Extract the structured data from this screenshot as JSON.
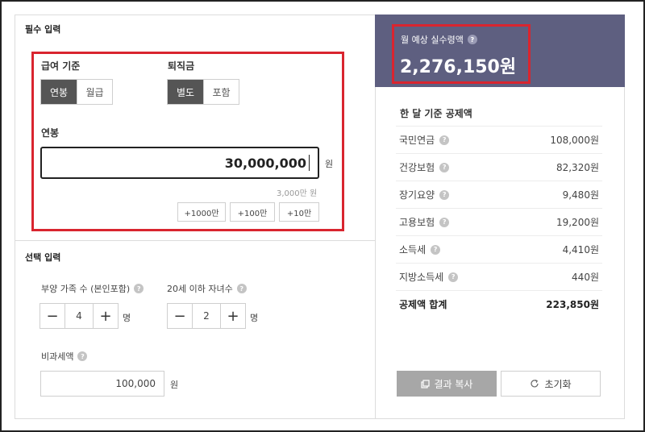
{
  "required": {
    "title": "필수 입력",
    "pay_basis": {
      "label": "급여 기준",
      "options": [
        "연봉",
        "월급"
      ],
      "selected": "연봉"
    },
    "severance": {
      "label": "퇴직금",
      "options": [
        "별도",
        "포함"
      ],
      "selected": "별도"
    },
    "salary": {
      "label": "연봉",
      "value": "30,000,000",
      "unit": "원",
      "hint": "3,000만 원",
      "add_buttons": [
        "+1000만",
        "+100만",
        "+10만"
      ]
    }
  },
  "optional": {
    "title": "선택 입력",
    "dependents": {
      "label": "부양 가족 수 (본인포함)",
      "value": "4",
      "unit": "명"
    },
    "children": {
      "label": "20세 이하 자녀수",
      "value": "2",
      "unit": "명"
    },
    "non_taxable": {
      "label": "비과세액",
      "value": "100,000",
      "unit": "원"
    }
  },
  "result": {
    "label": "월 예상 실수령액",
    "value": "2,276,150원",
    "deduction_title": "한 달 기준 공제액",
    "deductions": [
      {
        "name": "국민연금",
        "amount": "108,000원"
      },
      {
        "name": "건강보험",
        "amount": "82,320원"
      },
      {
        "name": "장기요양",
        "amount": "9,480원"
      },
      {
        "name": "고용보험",
        "amount": "19,200원"
      },
      {
        "name": "소득세",
        "amount": "4,410원"
      },
      {
        "name": "지방소득세",
        "amount": "440원"
      }
    ],
    "total": {
      "name": "공제액 합계",
      "amount": "223,850원"
    },
    "copy_button": "결과 복사",
    "reset_button": "초기화"
  },
  "colors": {
    "header_bg": "#5e5f80",
    "highlight_border": "#d9252f",
    "active_toggle": "#555555"
  },
  "icons": {
    "help": "question-circle-icon",
    "copy": "copy-icon",
    "reset": "refresh-icon"
  }
}
